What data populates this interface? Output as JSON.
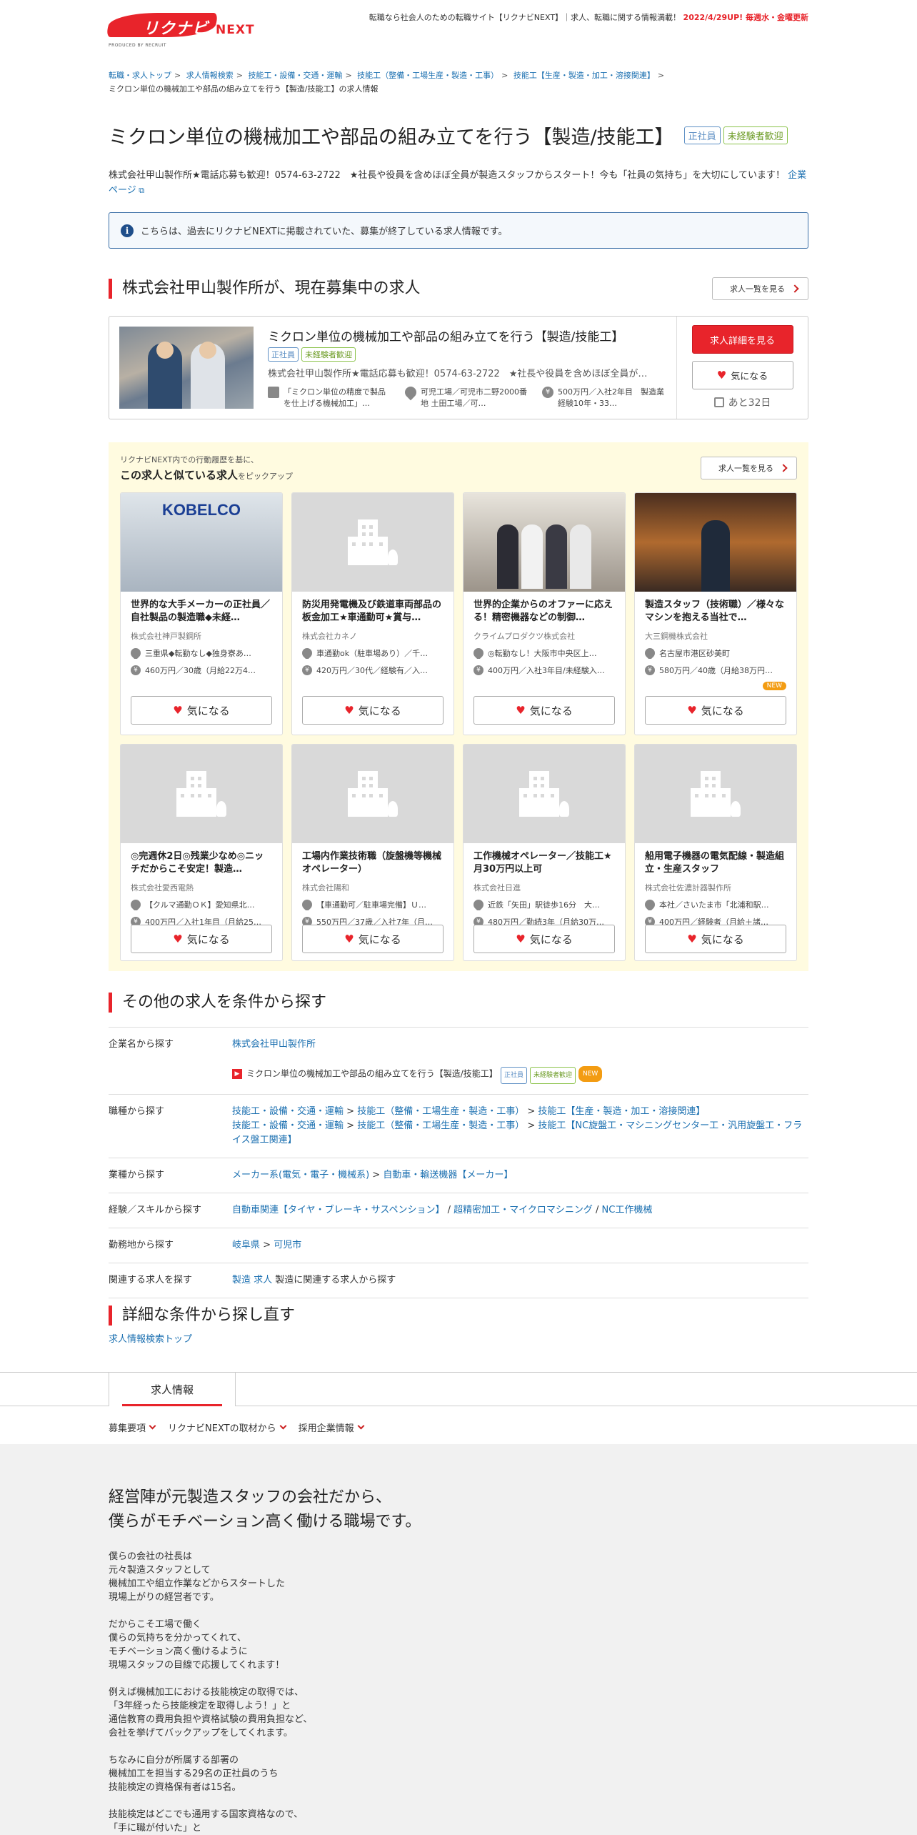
{
  "header": {
    "logo_kana": "リクナビ",
    "logo_next": "NEXT",
    "logo_sub": "PRODUCED BY RECRUIT",
    "tagline": "転職なら社会人のための転職サイト【リクナビNEXT】｜求人、転職に関する情報満載！",
    "update_notice": "2022/4/29UP! 毎週水・金曜更新"
  },
  "breadcrumb": [
    "転職・求人トップ",
    "求人情報検索",
    "技能工・設備・交通・運輸",
    "技能工（整備・工場生産・製造・工事）",
    "技能工【生産・製造・加工・溶接関連】"
  ],
  "breadcrumb_current": "ミクロン単位の機械加工や部品の組み立てを行う【製造/技能工】の求人情報",
  "job": {
    "title": "ミクロン単位の機械加工や部品の組み立てを行う【製造/技能工】",
    "tag_regular": "正社員",
    "tag_inexperienced": "未経験者歓迎",
    "lead": "株式会社甲山製作所★電話応募も歓迎！0574-63-2722　★社長や役員を含めほぼ全員が製造スタッフからスタート！今も「社員の気持ち」を大切にしています！",
    "company_page_link": "企業ページ"
  },
  "notice": {
    "icon": "info-icon",
    "text": "こちらは、過去にリクナビNEXTに掲載されていた、募集が終了している求人情報です。"
  },
  "current_section": {
    "heading": "株式会社甲山製作所が、現在募集中の求人",
    "list_button": "求人一覧を見る",
    "card": {
      "title": "ミクロン単位の機械加工や部品の組み立てを行う【製造/技能工】",
      "tag_regular": "正社員",
      "tag_inexperienced": "未経験者歓迎",
      "company_line": "株式会社甲山製作所★電話応募も歓迎！0574-63-2722　★社長や役員を含めほぼ全員が…",
      "work": "「ミクロン単位の精度で製品を仕上げる機械加工」…",
      "location": "可児工場／可児市二野2000番地 土田工場／可…",
      "salary": "500万円／入社2年目　製造業経験10年・33…",
      "detail_button": "求人詳細を見る",
      "fav_button": "気になる",
      "days_left": "あと32日"
    }
  },
  "picks": {
    "sub": "リクナビNEXT内での行動履歴を基に、",
    "heading": "この求人と似ている求人",
    "heading_suffix": "をピックアップ",
    "list_button": "求人一覧を見る",
    "fav_label": "気になる",
    "new_label": "NEW",
    "cards": [
      {
        "title": "世界的な大手メーカーの正社員／自社製品の製造職◆未経…",
        "company": "株式会社神戸製鋼所",
        "location": "三重県◆転勤なし◆独身寮あ…",
        "salary": "460万円／30歳（月給22万4…",
        "logo_text": "KOBELCO"
      },
      {
        "title": "防災用発電機及び鉄道車両部品の板金加工★車通勤可★賞与…",
        "company": "株式会社カネノ",
        "location": "車通勤ok（駐車場あり）／千…",
        "salary": "420万円／30代／経験有／入…"
      },
      {
        "title": "世界的企業からのオファーに応える！精密機器などの制御…",
        "company": "クライムプロダクツ株式会社",
        "location": "◎転勤なし！大阪市中央区上…",
        "salary": "400万円／入社3年目/未経験入…"
      },
      {
        "title": "製造スタッフ（技術職）／様々なマシンを抱える当社で…",
        "company": "大三鋼機株式会社",
        "location": "名古屋市港区砂美町",
        "salary": "580万円／40歳（月給38万円…"
      },
      {
        "title": "◎完週休2日◎残業少なめ◎ニッチだからこそ安定！製造…",
        "company": "株式会社愛西電熱",
        "location": "【クルマ通勤ＯＫ】愛知県北…",
        "salary": "400万円／入社1年目（月給25…"
      },
      {
        "title": "工場内作業技術職（旋盤機等機械オペレーター）",
        "company": "株式会社陽和",
        "location": "【車通勤可／駐車場完備】Ｕ…",
        "salary": "550万円／37歳／入社7年（月…"
      },
      {
        "title": "工作機械オペレーター／技能工★月30万円以上可",
        "company": "株式会社日進",
        "location": "近鉄「矢田」駅徒歩16分　大…",
        "salary": "480万円／勤続3年（月給30万…"
      },
      {
        "title": "船用電子機器の電気配線・製造組立・生産スタッフ",
        "company": "株式会社佐濃計器製作所",
        "location": "本社／さいたま市「北浦和駅…",
        "salary": "400万円／経験者（月給＋諸…"
      }
    ]
  },
  "search": {
    "heading": "その他の求人を条件から探す",
    "rows": {
      "company_key": "企業名から探す",
      "company_link": "株式会社甲山製作所",
      "company_job": "ミクロン単位の機械加工や部品の組み立てを行う【製造/技能工】",
      "occupation_key": "職種から探す",
      "occ1a": "技能工・設備・交通・運輸",
      "occ1b": "技能工（整備・工場生産・製造・工事）",
      "occ1c": "技能工【生産・製造・加工・溶接関連】",
      "occ2a": "技能工・設備・交通・運輸",
      "occ2b": "技能工（整備・工場生産・製造・工事）",
      "occ2c": "技能工【NC旋盤工・マシニングセンター工・汎用旋盤工・フライス盤工関連】",
      "industry_key": "業種から探す",
      "ind_a": "メーカー系(電気・電子・機械系)",
      "ind_b": "自動車・輸送機器【メーカー】",
      "skill_key": "経験／スキルから探す",
      "skill_a": "自動車関連【タイヤ・ブレーキ・サスペンション】",
      "skill_b": "超精密加工・マイクロマシニング",
      "skill_c": "NC工作機械",
      "area_key": "勤務地から探す",
      "area_a": "岐阜県",
      "area_b": "可児市",
      "related_key": "関連する求人を探す",
      "related_link": "製造 求人",
      "related_text": "製造に関連する求人から探す"
    }
  },
  "refine": {
    "heading": "詳細な条件から探し直す",
    "link": "求人情報検索トップ"
  },
  "footer_tab": "求人情報",
  "footer_nav": [
    "募集要項",
    "リクナビNEXTの取材から",
    "採用企業情報"
  ],
  "article": {
    "heading_1": "経営陣が元製造スタッフの会社だから、",
    "heading_2": "僕らがモチベーション高く働ける職場です。",
    "body": "僕らの会社の社長は\n元々製造スタッフとして\n機械加工や組立作業などからスタートした\n現場上がりの経営者です。\n\nだからこそ工場で働く\n僕らの気持ちを分かってくれて、\nモチベーション高く働けるように\n現場スタッフの目線で応援してくれます！\n\n例えば機械加工における技能検定の取得では、\n「3年経ったら技能検定を取得しよう！」と\n通信教育の費用負担や資格試験の費用負担など、\n会社を挙げてバックアップをしてくれます。\n\nちなみに自分が所属する部署の\n機械加工を担当する29名の正社員のうち\n技能検定の資格保有者は15名。\n\n技能検定はどこでも通用する国家資格なので、\n「手に職が付いた」と"
  },
  "colors": {
    "accent": "#e8242b",
    "link": "#1a6fb0",
    "picks_bg": "#fffbe0",
    "notice_border": "#3b6fa7"
  }
}
